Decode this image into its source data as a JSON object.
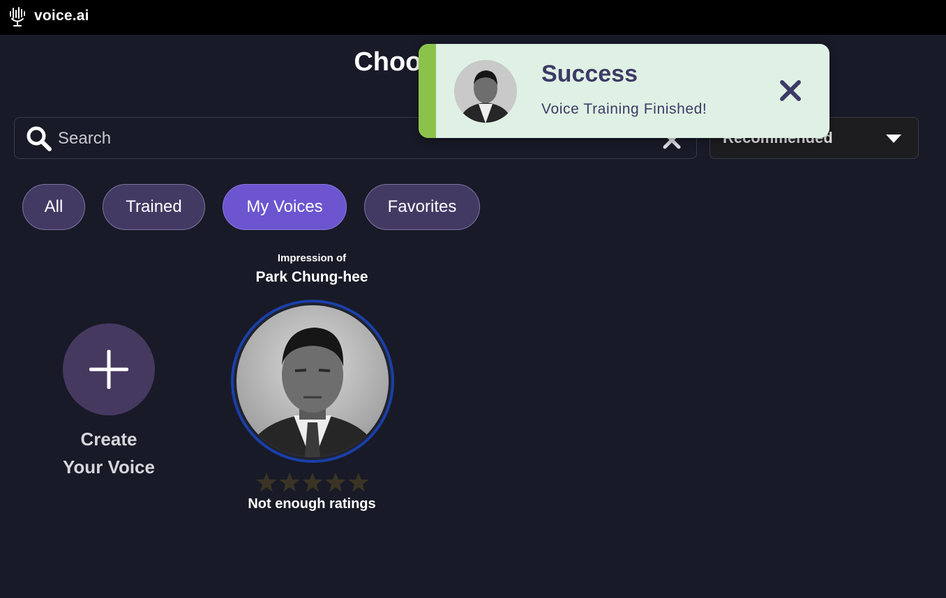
{
  "app": {
    "name": "voice.ai"
  },
  "page": {
    "title": "Choose your Voice"
  },
  "search": {
    "placeholder": "Search",
    "value": ""
  },
  "sort": {
    "selected": "Recommended"
  },
  "tabs": [
    {
      "label": "All",
      "active": false
    },
    {
      "label": "Trained",
      "active": false
    },
    {
      "label": "My Voices",
      "active": true
    },
    {
      "label": "Favorites",
      "active": false
    }
  ],
  "create": {
    "label_line1": "Create",
    "label_line2": "Your Voice",
    "icon": "plus-icon"
  },
  "voice_card": {
    "subtitle": "Impression of",
    "name": "Park Chung-hee",
    "rating_stars": 0,
    "rating_max": 5,
    "rating_text": "Not enough ratings"
  },
  "toast": {
    "title": "Success",
    "message": "Voice Training Finished!",
    "icon": "close-icon"
  },
  "colors": {
    "background": "#181a27",
    "titlebar": "#000000",
    "tab_active": "#6c55cf",
    "tab_inactive": "#433a64",
    "toast_bg": "#dff1e4",
    "toast_accent": "#8bc34a",
    "toast_text": "#3d3a66",
    "avatar_ring": "#1a3fa8"
  }
}
